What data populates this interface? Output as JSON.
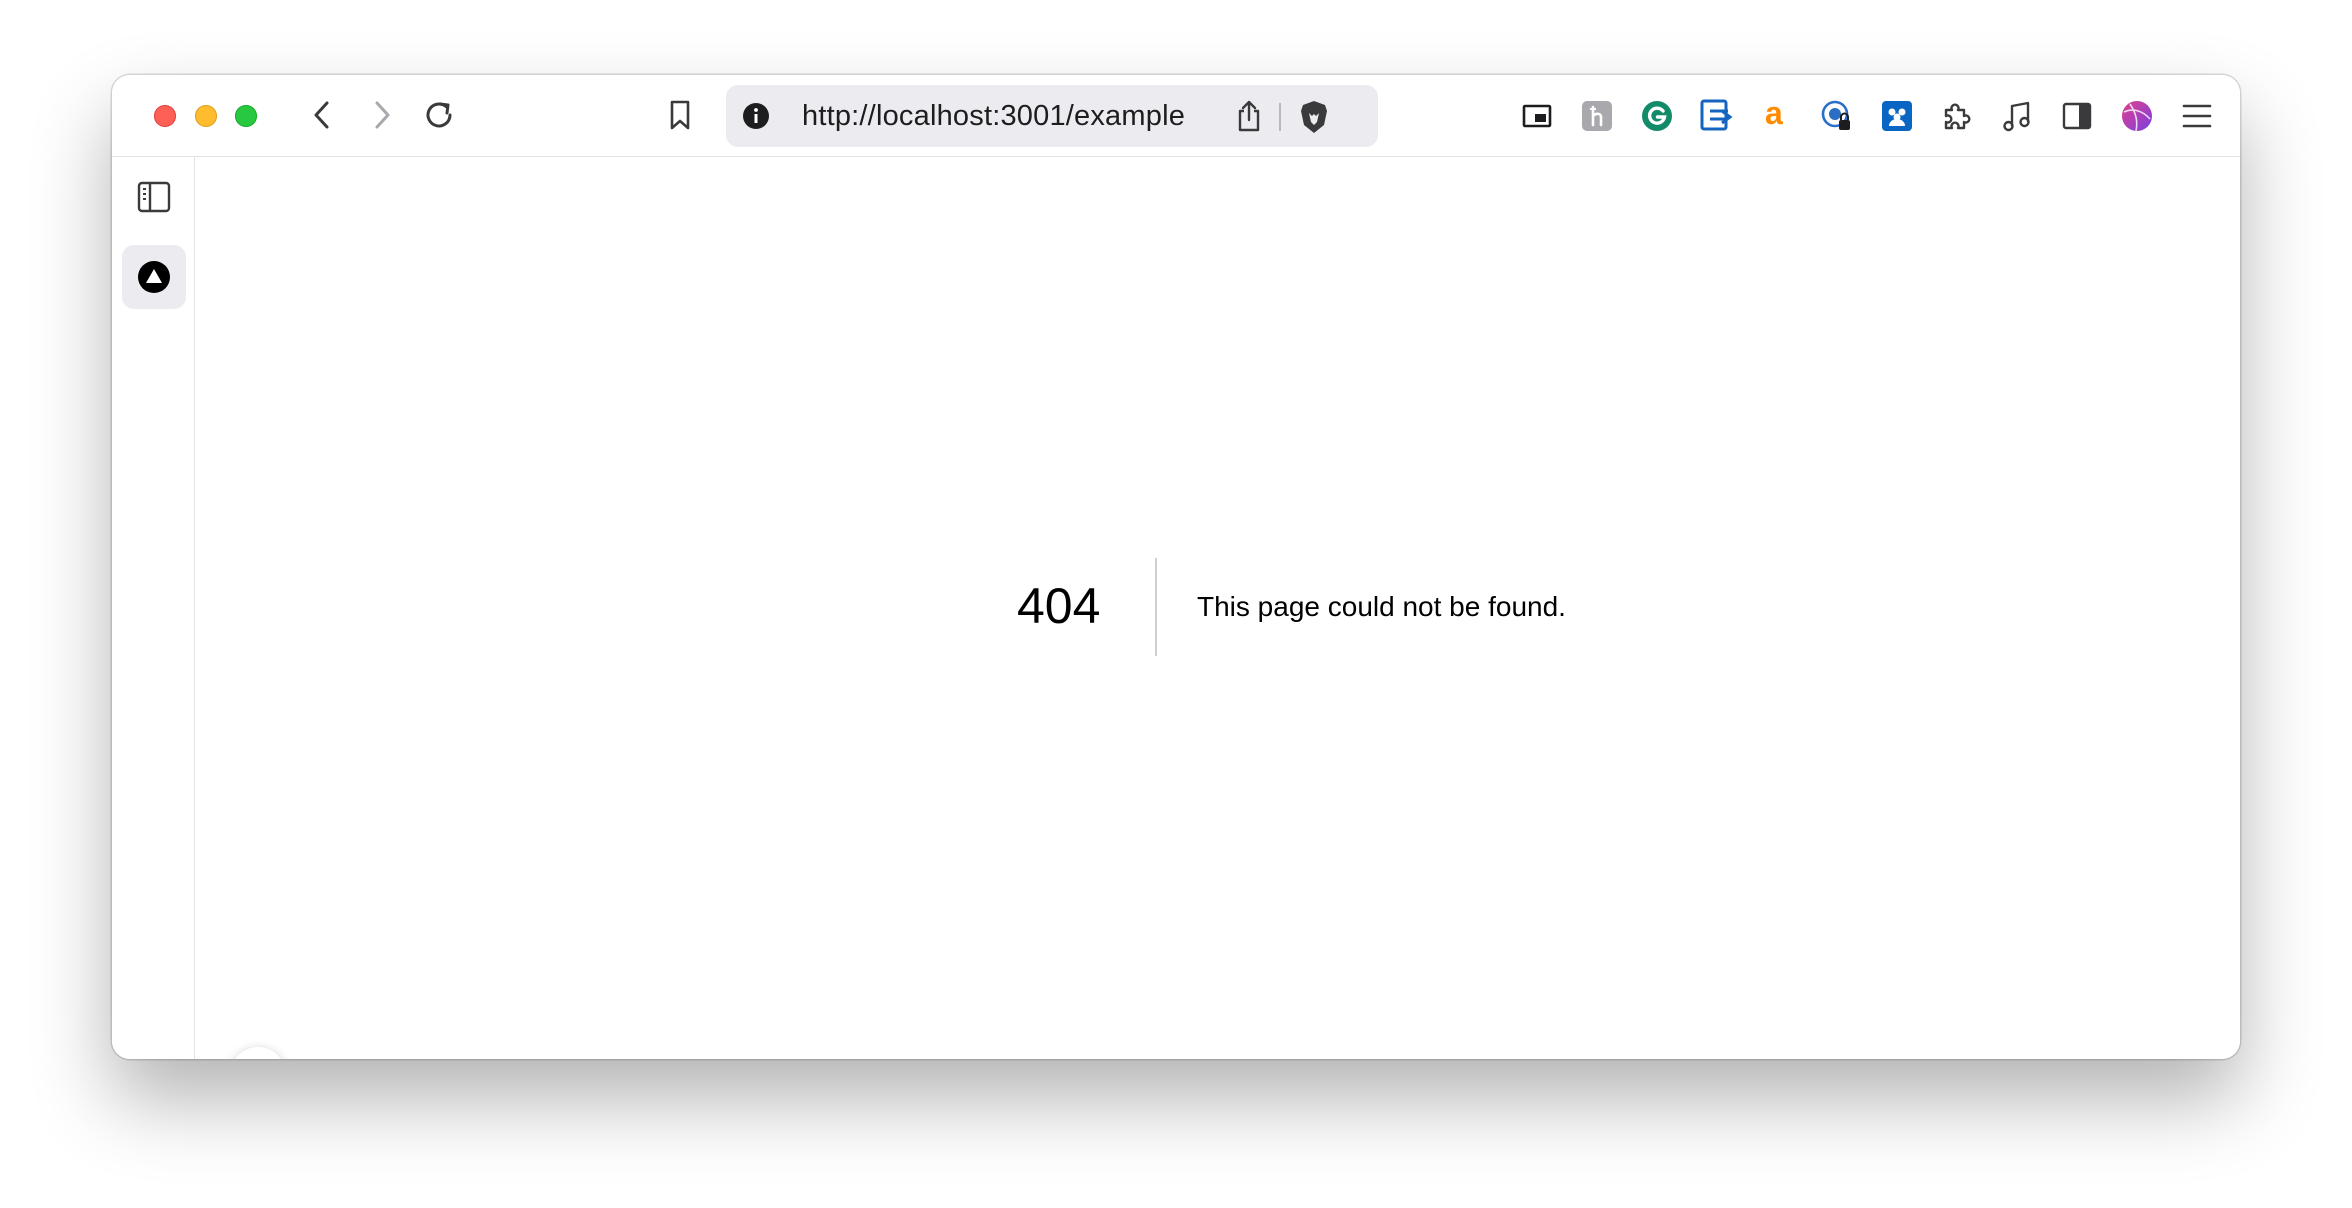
{
  "browser": {
    "url": "http://localhost:3001/example",
    "toolbar_icons": [
      "back-icon",
      "forward-icon",
      "reload-icon",
      "bookmark-icon",
      "site-info-icon",
      "share-icon",
      "brave-shields-icon",
      "picture-in-picture-icon",
      "extension-h-icon",
      "grammarly-icon",
      "extension-arrow-icon",
      "amazon-assistant-icon",
      "extension-lock-icon",
      "extension-users-icon",
      "extensions-puzzle-icon",
      "media-music-icon",
      "sidebar-toggle-icon",
      "profile-avatar-icon",
      "menu-icon"
    ]
  },
  "page": {
    "error_code": "404",
    "error_message": "This page could not be found."
  },
  "colors": {
    "close": "#fe5f57",
    "minimize": "#febc2e",
    "zoom": "#28c840",
    "grammarly": "#15c39a",
    "amazon": "#ff9900",
    "extension_blue": "#0a66c2"
  }
}
